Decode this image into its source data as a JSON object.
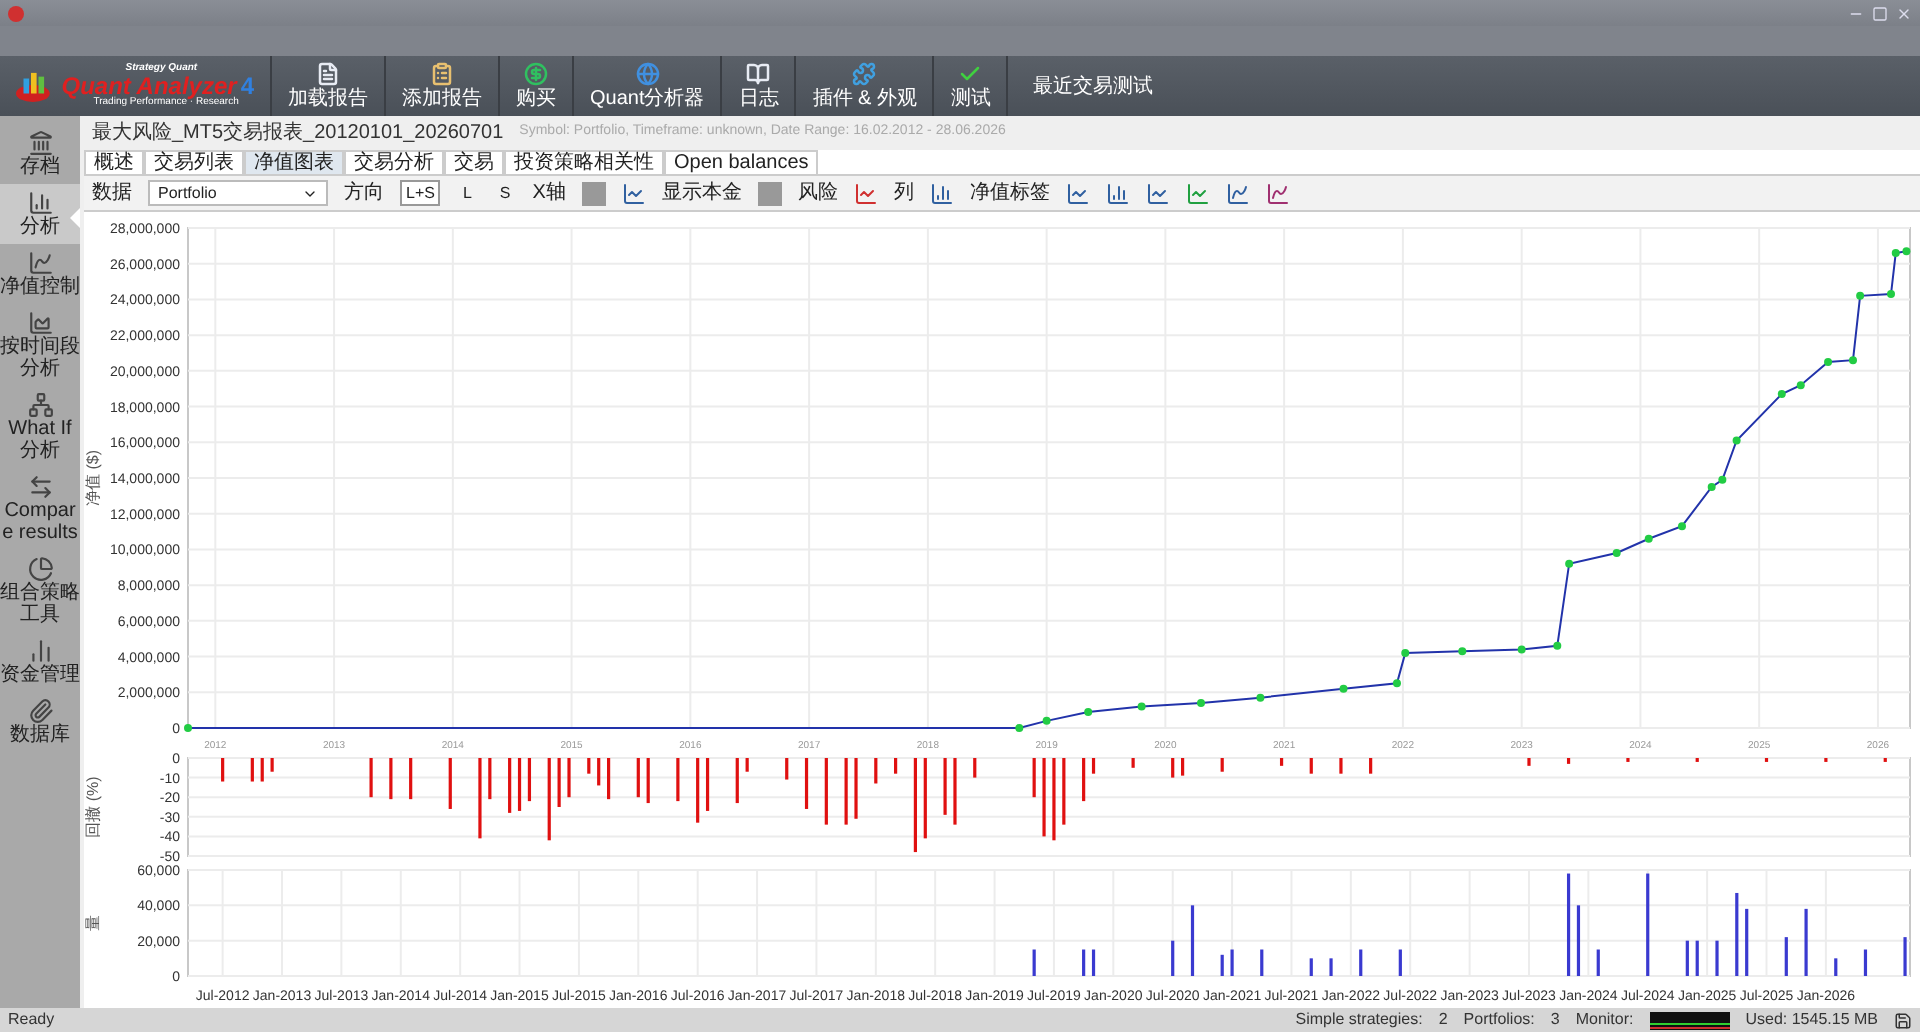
{
  "toolbar": {
    "logo": {
      "brand": "Strategy Quant",
      "name": "Quant Analyzer",
      "version": "4",
      "tagline": "Trading Performance · Research"
    },
    "buttons": [
      {
        "label": "加载报告"
      },
      {
        "label": "添加报告"
      },
      {
        "label": "购买"
      },
      {
        "label": "Quant分析器"
      },
      {
        "label": "日志"
      },
      {
        "label": "插件 & 外观"
      },
      {
        "label": "测试"
      }
    ],
    "extra": "最近交易测试"
  },
  "sidebar": {
    "items": [
      {
        "label": "存档",
        "selected": false
      },
      {
        "label": "分析",
        "selected": true
      },
      {
        "label": "净值控制",
        "selected": false
      },
      {
        "label": "按时间段分析",
        "selected": false
      },
      {
        "label": "What If 分析",
        "selected": false
      },
      {
        "label": "Compare results",
        "selected": false
      },
      {
        "label": "组合策略工具",
        "selected": false
      },
      {
        "label": "资金管理",
        "selected": false
      },
      {
        "label": "数据库",
        "selected": false
      }
    ]
  },
  "report": {
    "title": "最大风险_MT5交易报表_20120101_20260701",
    "info": "Symbol: Portfolio, Timeframe: unknown, Date Range: 16.02.2012 - 28.06.2026"
  },
  "tabs": [
    {
      "label": "概述",
      "selected": false
    },
    {
      "label": "交易列表",
      "selected": false
    },
    {
      "label": "净值图表",
      "selected": true
    },
    {
      "label": "交易分析",
      "selected": false
    },
    {
      "label": "交易",
      "selected": false
    },
    {
      "label": "投资策略相关性",
      "selected": false
    },
    {
      "label": "Open balances",
      "selected": false
    }
  ],
  "chart_toolbar": {
    "data_label": "数据",
    "data_value": "Portfolio",
    "direction_label": "方向",
    "directions": [
      {
        "label": "L+S",
        "selected": true
      },
      {
        "label": "L",
        "selected": false
      },
      {
        "label": "S",
        "selected": false
      }
    ],
    "x_axis_label": "X轴",
    "show_capital_label": "显示本金",
    "risk_label": "风险",
    "columns_label": "列",
    "equity_label": "净值标签"
  },
  "charts": [
    {
      "chart_data": {
        "type": "line",
        "grid": true,
        "ylabel": "净值 ($)",
        "xlim": [
          2012.27,
          2026.77
        ],
        "ylim": [
          0,
          28000000
        ],
        "yticks": [
          {
            "value": 0,
            "label": "0"
          },
          {
            "value": 2000000,
            "label": "2,000,000"
          },
          {
            "value": 4000000,
            "label": "4,000,000"
          },
          {
            "value": 6000000,
            "label": "6,000,000"
          },
          {
            "value": 8000000,
            "label": "8,000,000"
          },
          {
            "value": 10000000,
            "label": "10,000,000"
          },
          {
            "value": 12000000,
            "label": "12,000,000"
          },
          {
            "value": 14000000,
            "label": "14,000,000"
          },
          {
            "value": 16000000,
            "label": "16,000,000"
          },
          {
            "value": 18000000,
            "label": "18,000,000"
          },
          {
            "value": 20000000,
            "label": "20,000,000"
          },
          {
            "value": 22000000,
            "label": "22,000,000"
          },
          {
            "value": 24000000,
            "label": "24,000,000"
          },
          {
            "value": 26000000,
            "label": "26,000,000"
          },
          {
            "value": 28000000,
            "label": "28,000,000"
          }
        ],
        "xticks": [
          {
            "value": 2012.5,
            "label": "2012"
          },
          {
            "value": 2013.5,
            "label": "2013"
          },
          {
            "value": 2014.5,
            "label": "2014"
          },
          {
            "value": 2015.5,
            "label": "2015"
          },
          {
            "value": 2016.5,
            "label": "2016"
          },
          {
            "value": 2017.5,
            "label": "2017"
          },
          {
            "value": 2018.5,
            "label": "2018"
          },
          {
            "value": 2019.5,
            "label": "2019"
          },
          {
            "value": 2020.5,
            "label": "2020"
          },
          {
            "value": 2021.5,
            "label": "2021"
          },
          {
            "value": 2022.5,
            "label": "2022"
          },
          {
            "value": 2023.5,
            "label": "2023"
          },
          {
            "value": 2024.5,
            "label": "2024"
          },
          {
            "value": 2025.5,
            "label": "2025"
          },
          {
            "value": 2026.5,
            "label": "2026"
          }
        ],
        "x": [
          2012.27,
          2019.27,
          2019.5,
          2019.85,
          2020.3,
          2020.8,
          2021.3,
          2022.0,
          2022.45,
          2022.52,
          2023.0,
          2023.5,
          2023.8,
          2023.9,
          2024.3,
          2024.57,
          2024.85,
          2025.1,
          2025.19,
          2025.31,
          2025.69,
          2025.85,
          2026.08,
          2026.29,
          2026.35,
          2026.61,
          2026.65,
          2026.74
        ],
        "series": [
          {
            "color": "#2233aa",
            "marker": true,
            "values": [
              0,
              0,
              400000,
              900000,
              1200000,
              1400000,
              1700000,
              2200000,
              2500000,
              4200000,
              4300000,
              4400000,
              4600000,
              9200000,
              9800000,
              10600000,
              11300000,
              13500000,
              13900000,
              16100000,
              18700000,
              19200000,
              20500000,
              20600000,
              24200000,
              24300000,
              26600000,
              26700000
            ]
          }
        ]
      }
    },
    {
      "chart_data": {
        "type": "bar",
        "grid": true,
        "ylabel": "回撤 (%)",
        "ylim": [
          -50,
          0
        ],
        "yticks": [
          0,
          -10,
          -20,
          -30,
          -40,
          -50
        ],
        "categories": [
          null,
          null,
          null,
          null,
          null,
          null,
          null,
          null,
          null,
          null,
          null,
          null,
          null,
          null,
          null,
          null,
          null,
          null,
          null,
          null,
          null,
          null,
          null,
          null,
          null,
          null,
          null,
          null,
          null,
          null,
          null,
          null,
          null,
          null,
          null,
          null,
          null,
          null,
          null,
          null,
          null,
          null,
          null,
          null,
          null,
          null,
          null,
          null,
          null,
          null,
          null,
          null,
          null,
          null,
          null,
          null,
          null,
          null,
          null,
          null,
          null,
          null,
          null,
          null,
          null,
          null,
          null,
          null,
          null,
          null,
          null,
          null,
          null,
          null,
          null,
          null,
          null,
          null,
          null,
          null,
          null,
          null,
          null,
          null,
          null,
          null,
          null,
          null,
          null,
          null,
          null,
          null,
          null,
          null,
          null,
          null,
          null,
          null,
          null,
          null,
          null,
          null,
          null,
          null,
          null,
          null,
          null,
          null,
          null,
          null,
          null,
          null,
          null,
          null,
          null,
          null,
          null,
          null,
          null,
          null,
          null,
          null,
          null,
          null,
          null,
          null,
          null,
          null,
          null,
          null,
          null,
          null,
          null,
          null,
          null,
          null,
          null,
          null,
          null,
          null,
          null,
          null,
          null,
          null,
          null,
          null,
          null,
          null,
          null,
          null,
          null,
          null,
          null,
          null,
          null,
          null,
          null,
          null,
          null,
          null,
          null,
          null,
          null,
          null,
          null,
          null,
          null,
          null,
          null,
          null,
          null,
          null,
          null,
          null
        ],
        "series": [
          {
            "color": "#e01010",
            "values": [
              null,
              null,
              null,
              -12,
              null,
              null,
              -12,
              -12,
              -7,
              null,
              null,
              null,
              null,
              null,
              null,
              null,
              null,
              null,
              -20,
              null,
              -21,
              null,
              -21,
              null,
              null,
              null,
              -26,
              null,
              null,
              -41,
              -21,
              null,
              -28,
              -27,
              -22,
              null,
              -42,
              -25,
              -20,
              null,
              -8,
              -14,
              -21,
              null,
              null,
              -20,
              -23,
              null,
              null,
              -22,
              null,
              -33,
              -27,
              null,
              null,
              -23,
              -7,
              null,
              null,
              null,
              -11,
              null,
              -26,
              null,
              -34,
              null,
              -34,
              -31,
              null,
              -13,
              null,
              -8,
              null,
              -48,
              -41,
              null,
              -29,
              -34,
              null,
              -10,
              null,
              null,
              null,
              null,
              null,
              -20,
              -40,
              -42,
              -34,
              null,
              -22,
              -8,
              null,
              null,
              null,
              -5,
              null,
              null,
              null,
              -10,
              -9,
              null,
              null,
              null,
              -7,
              null,
              null,
              null,
              null,
              null,
              -4,
              null,
              null,
              -8,
              null,
              null,
              -8,
              null,
              null,
              -8,
              null,
              null,
              null,
              null,
              null,
              null,
              null,
              null,
              null,
              null,
              null,
              null,
              null,
              null,
              null,
              -4,
              null,
              null,
              null,
              -3,
              null,
              null,
              null,
              null,
              null,
              -2,
              null,
              null,
              null,
              null,
              null,
              null,
              -2,
              null,
              null,
              null,
              null,
              null,
              null,
              -2,
              null,
              null,
              null,
              null,
              null,
              -2,
              null,
              null,
              null,
              null,
              null,
              -2,
              null,
              null
            ]
          }
        ]
      }
    },
    {
      "chart_data": {
        "type": "bar",
        "grid": true,
        "ylabel": "量",
        "ylim": [
          0,
          60000
        ],
        "yticks": [
          {
            "value": 0,
            "label": "0"
          },
          {
            "value": 20000,
            "label": "20,000"
          },
          {
            "value": 40000,
            "label": "40,000"
          },
          {
            "value": 60000,
            "label": "60,000"
          }
        ],
        "categories": [
          null,
          null,
          null,
          "Jul-2012",
          null,
          null,
          null,
          null,
          null,
          "Jan-2013",
          null,
          null,
          null,
          null,
          null,
          "Jul-2013",
          null,
          null,
          null,
          null,
          null,
          "Jan-2014",
          null,
          null,
          null,
          null,
          null,
          "Jul-2014",
          null,
          null,
          null,
          null,
          null,
          "Jan-2015",
          null,
          null,
          null,
          null,
          null,
          "Jul-2015",
          null,
          null,
          null,
          null,
          null,
          "Jan-2016",
          null,
          null,
          null,
          null,
          null,
          "Jul-2016",
          null,
          null,
          null,
          null,
          null,
          "Jan-2017",
          null,
          null,
          null,
          null,
          null,
          "Jul-2017",
          null,
          null,
          null,
          null,
          null,
          "Jan-2018",
          null,
          null,
          null,
          null,
          null,
          "Jul-2018",
          null,
          null,
          null,
          null,
          null,
          "Jan-2019",
          null,
          null,
          null,
          null,
          null,
          "Jul-2019",
          null,
          null,
          null,
          null,
          null,
          "Jan-2020",
          null,
          null,
          null,
          null,
          null,
          "Jul-2020",
          null,
          null,
          null,
          null,
          null,
          "Jan-2021",
          null,
          null,
          null,
          null,
          null,
          "Jul-2021",
          null,
          null,
          null,
          null,
          null,
          "Jan-2022",
          null,
          null,
          null,
          null,
          null,
          "Jul-2022",
          null,
          null,
          null,
          null,
          null,
          "Jan-2023",
          null,
          null,
          null,
          null,
          null,
          "Jul-2023",
          null,
          null,
          null,
          null,
          null,
          "Jan-2024",
          null,
          null,
          null,
          null,
          null,
          "Jul-2024",
          null,
          null,
          null,
          null,
          null,
          "Jan-2025",
          null,
          null,
          null,
          null,
          null,
          "Jul-2025",
          null,
          null,
          null,
          null,
          null,
          "Jan-2026",
          null,
          null,
          null,
          null,
          null,
          null,
          null,
          null
        ],
        "series": [
          {
            "color": "#3a3ad0",
            "values": [
              null,
              null,
              null,
              null,
              null,
              null,
              null,
              null,
              null,
              null,
              null,
              null,
              null,
              null,
              null,
              null,
              null,
              null,
              null,
              null,
              null,
              null,
              null,
              null,
              null,
              null,
              null,
              null,
              null,
              null,
              null,
              null,
              null,
              null,
              null,
              null,
              null,
              null,
              null,
              null,
              null,
              null,
              null,
              null,
              null,
              null,
              null,
              null,
              null,
              null,
              null,
              null,
              null,
              null,
              null,
              null,
              null,
              null,
              null,
              null,
              null,
              null,
              null,
              null,
              null,
              null,
              null,
              null,
              null,
              null,
              null,
              null,
              null,
              null,
              null,
              null,
              null,
              null,
              null,
              null,
              null,
              null,
              null,
              null,
              null,
              15000,
              null,
              null,
              null,
              null,
              15000,
              15000,
              null,
              null,
              null,
              null,
              null,
              null,
              null,
              20000,
              null,
              40000,
              null,
              null,
              12000,
              15000,
              null,
              null,
              15000,
              null,
              null,
              null,
              null,
              10000,
              null,
              10000,
              null,
              null,
              15000,
              null,
              null,
              null,
              15000,
              null,
              null,
              null,
              null,
              null,
              null,
              null,
              null,
              null,
              null,
              null,
              null,
              null,
              null,
              null,
              null,
              58000,
              40000,
              null,
              15000,
              null,
              null,
              null,
              null,
              58000,
              null,
              null,
              null,
              20000,
              20000,
              null,
              20000,
              null,
              47000,
              38000,
              null,
              null,
              null,
              22000,
              null,
              38000,
              null,
              null,
              10000,
              null,
              null,
              15000,
              null,
              null,
              null,
              22000
            ]
          }
        ]
      }
    }
  ],
  "status_bar": {
    "text": "Ready",
    "simple_strategies_label": "Simple strategies:",
    "simple_strategies": "2",
    "portfolios_label": "Portfolios:",
    "portfolios": "3",
    "monitor_label": "Monitor:",
    "memory": "Used: 1545.15 MB"
  }
}
